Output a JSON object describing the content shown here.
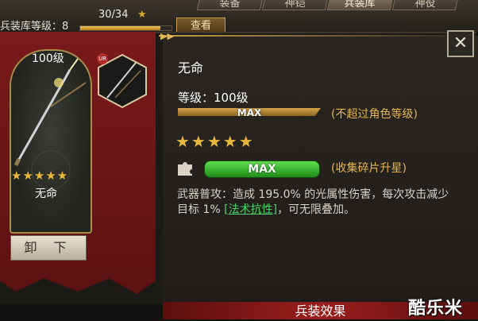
{
  "header": {
    "armory_level_label": "兵装库等级：8",
    "progress_text": "30/34",
    "progress_fraction": 0.88,
    "view_button": "查看",
    "tabs": [
      "装备",
      "神铠",
      "兵装库",
      "神役"
    ],
    "active_tab_index": 2
  },
  "card": {
    "level": "100级",
    "stars": "★★★★★",
    "name": "无命",
    "rarity_badge": "UR",
    "unequip_button": "卸 下"
  },
  "detail": {
    "name": "无命",
    "level": "等级：100级",
    "level_bar_text": "MAX",
    "level_note": "(不超过角色等级)",
    "stars": "★★★★★",
    "fragment_bar_text": "MAX",
    "fragment_note": "(收集碎片升星)",
    "desc_before": "武器普攻：造成 195.0% 的光属性伤害，每次攻击减少目标 1% ",
    "desc_link": "[法术抗性]",
    "desc_after": "，可无限叠加。"
  },
  "footer": {
    "effect_title": "兵装效果"
  },
  "watermark": "酷乐米",
  "icons": {
    "close": "close-icon",
    "puzzle": "puzzle-piece-icon",
    "weapon": "spear-icon"
  },
  "colors": {
    "banner": "#7a1a1c",
    "gold": "#e7b54a",
    "green": "#49d46a"
  }
}
